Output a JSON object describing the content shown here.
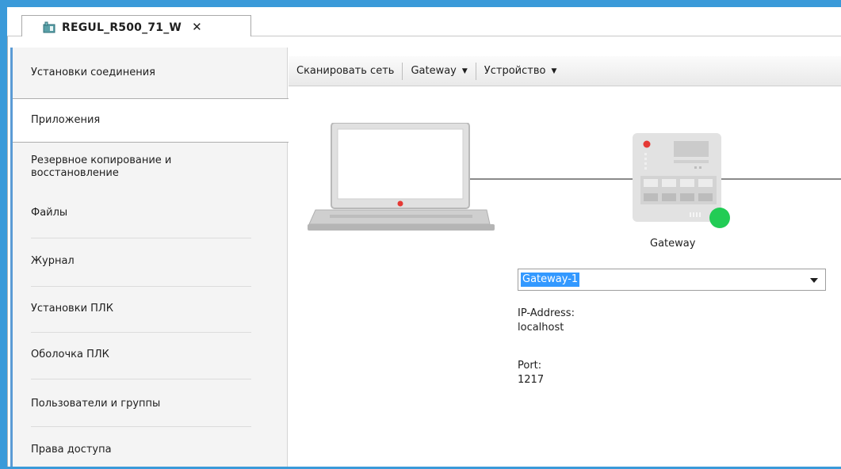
{
  "tab": {
    "title": "REGUL_R500_71_W",
    "close_icon": "close-icon",
    "icon": "device-icon"
  },
  "sidebar": {
    "items": [
      {
        "label": "Установки соединения"
      },
      {
        "label": "Приложения",
        "selected": true
      },
      {
        "label": "Резервное копирование и восстановление"
      },
      {
        "label": "Файлы"
      },
      {
        "label": "Журнал"
      },
      {
        "label": "Установки ПЛК"
      },
      {
        "label": "Оболочка ПЛК"
      },
      {
        "label": "Пользователи и группы"
      },
      {
        "label": "Права доступа"
      }
    ]
  },
  "toolbar": {
    "scan_label": "Сканировать сеть",
    "gateway_label": "Gateway",
    "device_label": "Устройство"
  },
  "diagram": {
    "gateway_label": "Gateway",
    "status_color": "#22cc55"
  },
  "gateway_select": {
    "value": "Gateway-1"
  },
  "ip": {
    "label": "IP-Address:",
    "value": "localhost"
  },
  "port": {
    "label": "Port:",
    "value": "1217"
  }
}
